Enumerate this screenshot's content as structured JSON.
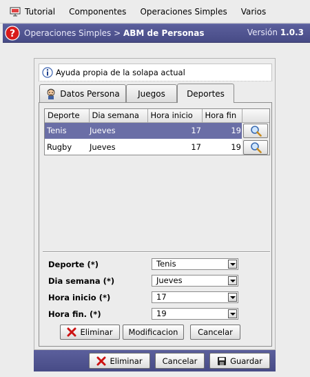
{
  "menu": {
    "items": [
      "Tutorial",
      "Componentes",
      "Operaciones Simples",
      "Varios"
    ]
  },
  "titlebar": {
    "path": "Operaciones Simples > ",
    "title": "ABM de Personas",
    "version_label": "Versión ",
    "version": "1.0.3"
  },
  "help": {
    "text": "Ayuda propia de la solapa actual"
  },
  "tabs": [
    {
      "label": "Datos Persona",
      "icon": "person-icon",
      "active": false
    },
    {
      "label": "Juegos",
      "active": false
    },
    {
      "label": "Deportes",
      "active": true
    }
  ],
  "table": {
    "columns": [
      "Deporte",
      "Dia semana",
      "Hora inicio",
      "Hora fin",
      ""
    ],
    "rows": [
      {
        "deporte": "Tenis",
        "dia": "Jueves",
        "inicio": "17",
        "fin": "19",
        "selected": true
      },
      {
        "deporte": "Rugby",
        "dia": "Jueves",
        "inicio": "17",
        "fin": "19",
        "selected": false
      }
    ]
  },
  "form": {
    "deporte_label": "Deporte (*)",
    "deporte_value": "Tenis",
    "dia_label": "Dia semana (*)",
    "dia_value": "Jueves",
    "inicio_label": "Hora inicio (*)",
    "inicio_value": "17",
    "fin_label": "Hora fin. (*)",
    "fin_value": "19"
  },
  "detail_buttons": {
    "eliminar": "Eliminar",
    "modificacion": "Modificacion",
    "cancelar": "Cancelar"
  },
  "main_buttons": {
    "eliminar": "Eliminar",
    "cancelar": "Cancelar",
    "guardar": "Guardar"
  },
  "colors": {
    "titlebar": "#4b4f8c",
    "selection": "#6a6ea6",
    "danger": "#cc1111"
  }
}
